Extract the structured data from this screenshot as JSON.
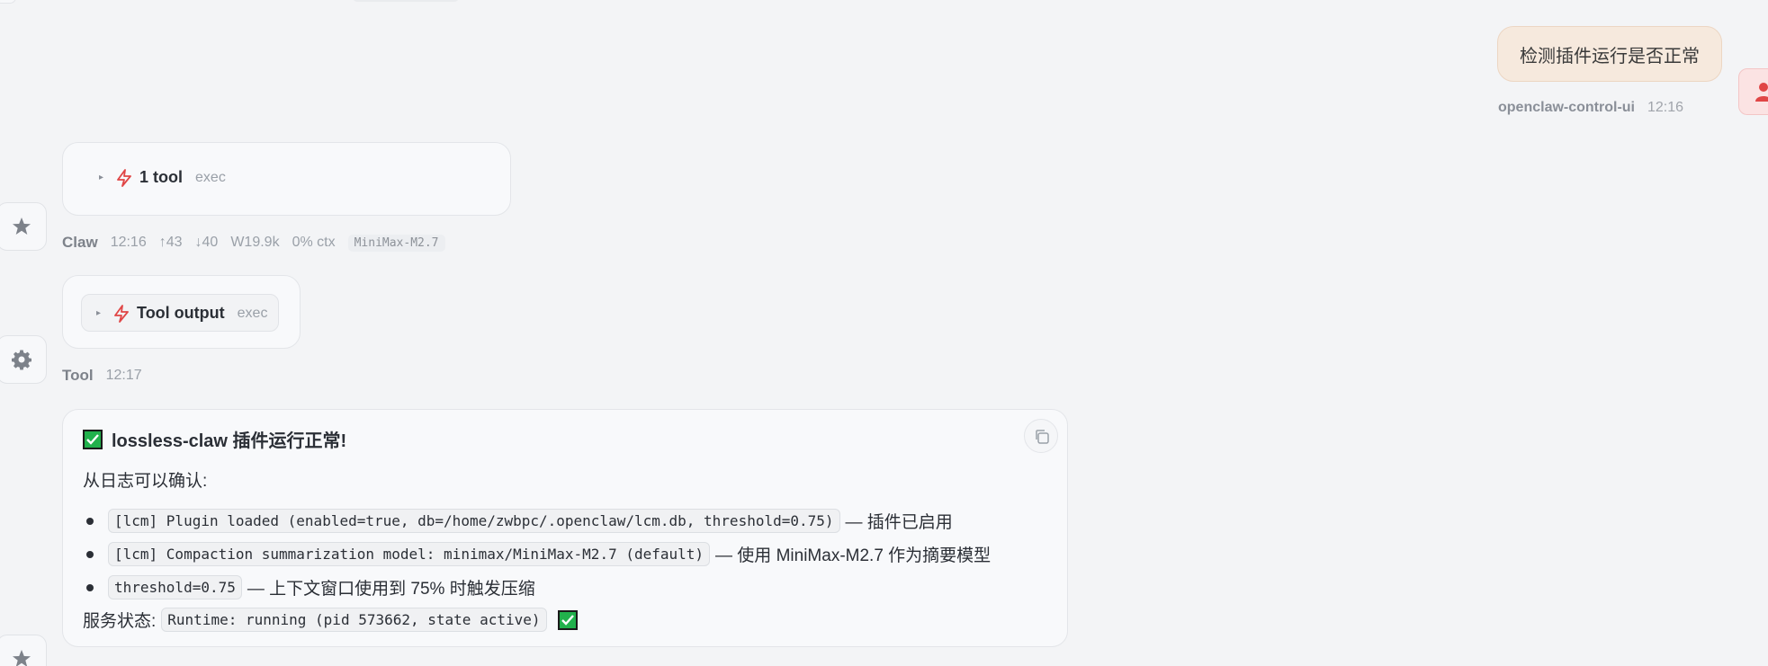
{
  "user_message": {
    "text": "检测插件运行是否正常",
    "sender": "openclaw-control-ui",
    "time": "12:16"
  },
  "tool_call": {
    "title": "1 tool",
    "kind": "exec",
    "meta": {
      "who": "Claw",
      "time": "12:16",
      "input_tokens": "↑43",
      "output_tokens": "↓40",
      "window": "W19.9k",
      "ctx": "0% ctx",
      "model": "MiniMax-M2.7"
    }
  },
  "tool_output": {
    "title": "Tool output",
    "kind": "exec",
    "meta": {
      "who": "Tool",
      "time": "12:17"
    }
  },
  "response": {
    "heading": "lossless-claw 插件运行正常!",
    "intro": "从日志可以确认:",
    "bullets": [
      {
        "code": "[lcm] Plugin loaded (enabled=true, db=/home/zwbpc/.openclaw/lcm.db, threshold=0.75)",
        "desc": "— 插件已启用"
      },
      {
        "code": "[lcm] Compaction summarization model: minimax/MiniMax-M2.7 (default)",
        "desc": "— 使用 MiniMax-M2.7 作为摘要模型"
      },
      {
        "code": "threshold=0.75",
        "desc": "— 上下文窗口使用到 75% 时触发压缩"
      }
    ],
    "status_label": "服务状态:",
    "status_code": "Runtime: running (pid 573662, state active)"
  },
  "icons": {
    "assistant_avatar": "star-icon",
    "tool_avatar": "gear-icon",
    "user_avatar": "user-icon",
    "tool_icon": "lightning-icon",
    "copy": "copy-icon",
    "check": "check-box-icon"
  },
  "colors": {
    "accent_red": "#e04646",
    "check_green": "#22b14c",
    "user_bubble": "#f6e9dd"
  }
}
